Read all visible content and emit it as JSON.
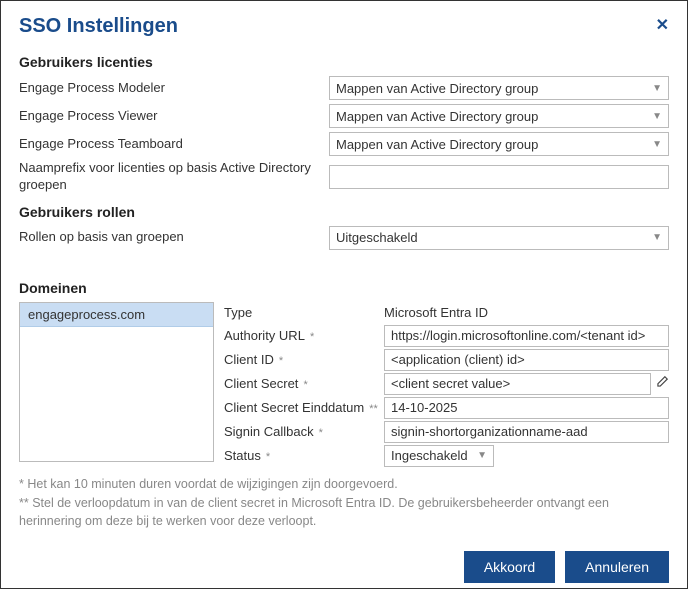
{
  "dialog": {
    "title": "SSO Instellingen"
  },
  "licenses": {
    "heading": "Gebruikers licenties",
    "rows": [
      {
        "label": "Engage Process Modeler",
        "value": "Mappen van Active Directory group"
      },
      {
        "label": "Engage Process Viewer",
        "value": "Mappen van Active Directory group"
      },
      {
        "label": "Engage Process Teamboard",
        "value": "Mappen van Active Directory group"
      }
    ],
    "prefix_label": "Naamprefix voor licenties op basis Active Directory groepen",
    "prefix_value": ""
  },
  "roles": {
    "heading": "Gebruikers rollen",
    "label": "Rollen op basis van groepen",
    "value": "Uitgeschakeld"
  },
  "domains": {
    "heading": "Domeinen",
    "list": [
      "engageprocess.com"
    ],
    "type_label": "Type",
    "type_value": "Microsoft Entra ID",
    "authority_label": "Authority URL",
    "authority_value": "https://login.microsoftonline.com/<tenant id>",
    "clientid_label": "Client ID",
    "clientid_value": "<application (client) id>",
    "secret_label": "Client Secret",
    "secret_value": "<client secret value>",
    "secret_end_label": "Client Secret Einddatum",
    "secret_end_value": "14-10-2025",
    "callback_label": "Signin Callback",
    "callback_value": "signin-shortorganizationname-aad",
    "status_label": "Status",
    "status_value": "Ingeschakeld"
  },
  "footnotes": {
    "line1": "*  Het kan 10 minuten duren voordat de wijzigingen zijn doorgevoerd.",
    "line2": "** Stel de verloopdatum in van de client secret in Microsoft Entra ID. De gebruikersbeheerder ontvangt een herinnering om deze bij te werken voor deze verloopt."
  },
  "buttons": {
    "ok": "Akkoord",
    "cancel": "Annuleren"
  }
}
